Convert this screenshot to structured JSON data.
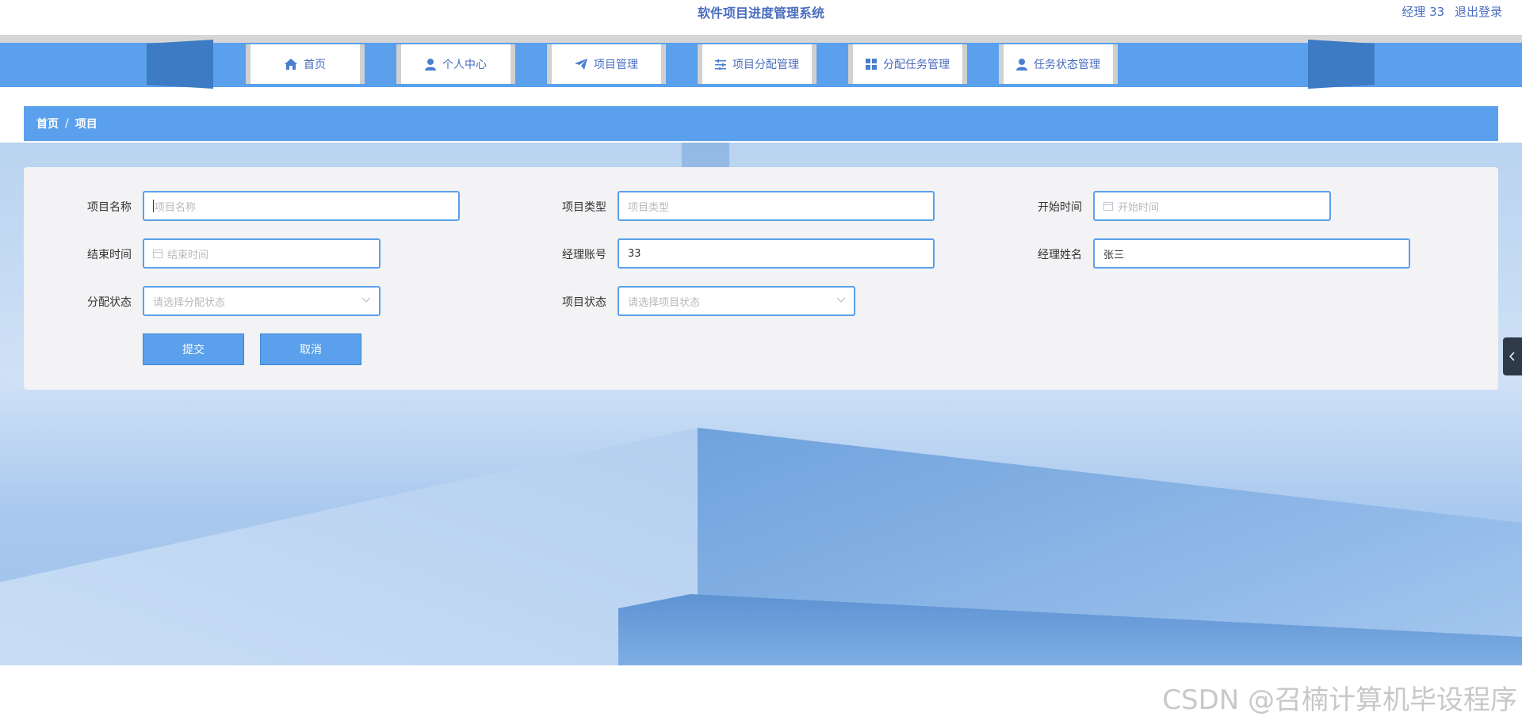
{
  "header": {
    "app_title": "软件项目进度管理系统",
    "user_label": "经理 33",
    "logout_label": "退出登录"
  },
  "nav": {
    "items": [
      {
        "label": "首页",
        "icon": "home-icon"
      },
      {
        "label": "个人中心",
        "icon": "user-icon"
      },
      {
        "label": "项目管理",
        "icon": "paper-plane-icon"
      },
      {
        "label": "项目分配管理",
        "icon": "sliders-icon"
      },
      {
        "label": "分配任务管理",
        "icon": "grid-icon"
      },
      {
        "label": "任务状态管理",
        "icon": "user-icon"
      }
    ]
  },
  "breadcrumb": {
    "home": "首页",
    "separator": "/",
    "current": "项目"
  },
  "form": {
    "project_name": {
      "label": "项目名称",
      "placeholder": "项目名称",
      "value": ""
    },
    "project_type": {
      "label": "项目类型",
      "placeholder": "项目类型",
      "value": ""
    },
    "start_time": {
      "label": "开始时间",
      "placeholder": "开始时间",
      "value": ""
    },
    "end_time": {
      "label": "结束时间",
      "placeholder": "结束时间",
      "value": ""
    },
    "manager_account": {
      "label": "经理账号",
      "placeholder": "",
      "value": "33"
    },
    "manager_name": {
      "label": "经理姓名",
      "placeholder": "",
      "value": "张三"
    },
    "assign_status": {
      "label": "分配状态",
      "placeholder": "请选择分配状态",
      "value": ""
    },
    "project_status": {
      "label": "项目状态",
      "placeholder": "请选择项目状态",
      "value": ""
    },
    "submit_label": "提交",
    "cancel_label": "取消"
  },
  "watermark": "CSDN @召楠计算机毕设程序",
  "colors": {
    "primary": "#5aa0ec",
    "dark_accent": "#3d7cc4",
    "title_text": "#4a6dbf"
  }
}
